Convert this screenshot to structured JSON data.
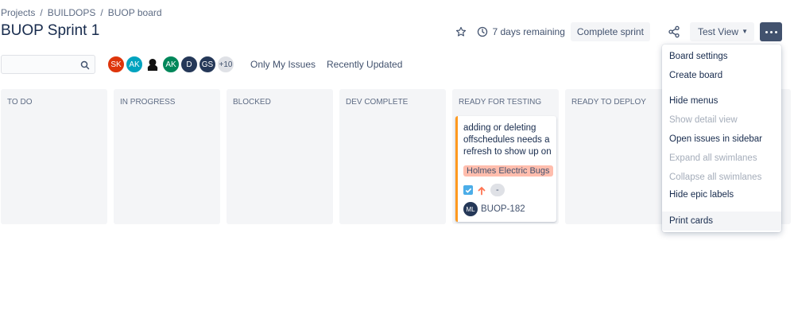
{
  "breadcrumb": [
    "Projects",
    "BUILDOPS",
    "BUOP board"
  ],
  "title": "BUOP Sprint 1",
  "header": {
    "remaining": "7 days remaining",
    "complete_sprint": "Complete sprint",
    "view_label": "Test View"
  },
  "search": {
    "value": "",
    "placeholder": ""
  },
  "avatars": [
    {
      "initials": "SK",
      "color": "#de350b"
    },
    {
      "initials": "AK",
      "color": "#00a3bf"
    },
    {
      "initials": "",
      "color": "#ffffff"
    },
    {
      "initials": "AK",
      "color": "#00875a"
    },
    {
      "initials": "D",
      "color": "#253858"
    },
    {
      "initials": "GS",
      "color": "#253858"
    },
    {
      "initials": "+10",
      "color": "#dfe1e6"
    }
  ],
  "filters": {
    "only_my_issues": "Only My Issues",
    "recently_updated": "Recently Updated"
  },
  "columns": [
    "TO DO",
    "IN PROGRESS",
    "BLOCKED",
    "DEV COMPLETE",
    "READY FOR TESTING",
    "READY TO DEPLOY"
  ],
  "card": {
    "summary": "adding or deleting offschedules needs a refresh to show up on",
    "epic": "Holmes Electric Bugs",
    "estimate": "-",
    "assignee_initials": "ML",
    "key": "BUOP-182"
  },
  "menu": [
    {
      "label": "Board settings",
      "disabled": false
    },
    {
      "label": "Create board",
      "disabled": false
    },
    {
      "label": "Hide menus",
      "disabled": false
    },
    {
      "label": "Show detail view",
      "disabled": true
    },
    {
      "label": "Open issues in sidebar",
      "disabled": false
    },
    {
      "label": "Expand all swimlanes",
      "disabled": true
    },
    {
      "label": "Collapse all swimlanes",
      "disabled": true
    },
    {
      "label": "Hide epic labels",
      "disabled": false
    },
    {
      "label": "Print cards",
      "disabled": false
    }
  ],
  "colors": {
    "accent": "#42526e",
    "card_border": "#ff991f",
    "epic_bg": "#ffbdad",
    "column_bg": "#f4f5f7"
  }
}
